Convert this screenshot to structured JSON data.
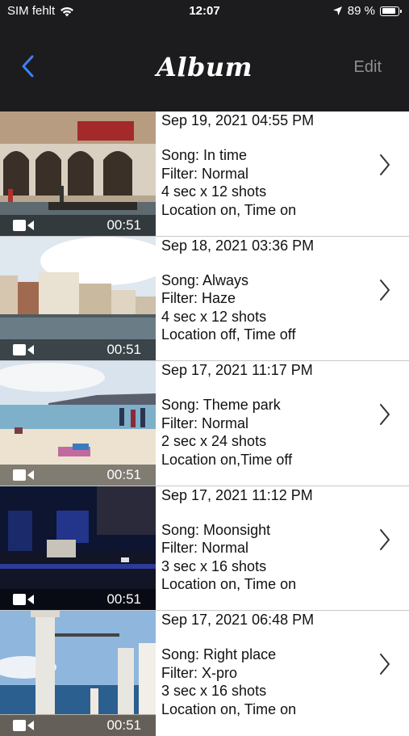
{
  "status_bar": {
    "carrier": "SIM fehlt",
    "time": "12:07",
    "battery_percent": "89 %",
    "battery_level": 0.89,
    "icons": [
      "wifi-icon",
      "location-arrow-icon",
      "battery-icon"
    ]
  },
  "nav": {
    "title": "Album",
    "edit_label": "Edit",
    "back_icon": "chevron-left-icon",
    "accent_color": "#3a82f7"
  },
  "rows": [
    {
      "date": "Sep 19, 2021 04:55 PM",
      "song": "Song: In time",
      "filter": "Filter: Normal",
      "shots": "4 sec x 12 shots",
      "location": "Location on, Time on",
      "duration": "00:51"
    },
    {
      "date": "Sep 18, 2021 03:36 PM",
      "song": "Song: Always",
      "filter": "Filter: Haze",
      "shots": "4 sec x 12 shots",
      "location": "Location off, Time off",
      "duration": "00:51"
    },
    {
      "date": "Sep 17, 2021 11:17 PM",
      "song": "Song: Theme park",
      "filter": "Filter: Normal",
      "shots": "2 sec x 24 shots",
      "location": "Location on,Time off",
      "duration": "00:51"
    },
    {
      "date": "Sep 17, 2021 11:12 PM",
      "song": "Song: Moonsight",
      "filter": "Filter: Normal",
      "shots": "3 sec x 16 shots",
      "location": "Location on, Time on",
      "duration": "00:51"
    },
    {
      "date": "Sep 17, 2021 06:48 PM",
      "song": "Song: Right place",
      "filter": "Filter: X-pro",
      "shots": "3 sec x 16 shots",
      "location": "Location on, Time on",
      "duration": "00:51"
    }
  ]
}
